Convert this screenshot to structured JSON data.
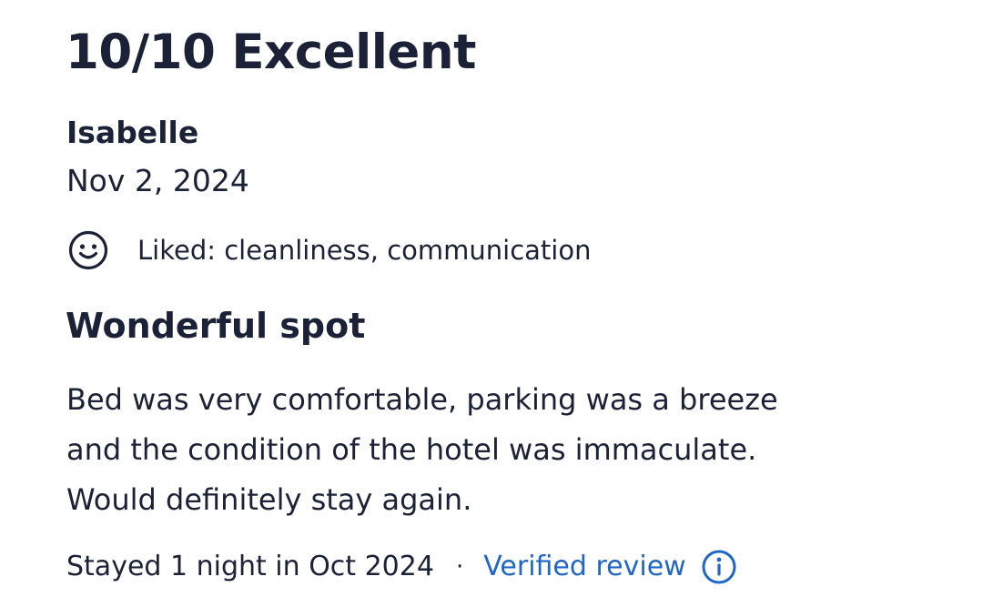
{
  "review": {
    "rating_heading": "10/10 Excellent",
    "reviewer_name": "Isabelle",
    "date": "Nov 2, 2024",
    "liked_icon": "smile-icon",
    "liked_text": "Liked: cleanliness, communication",
    "title": "Wonderful spot",
    "body_lines": [
      "Bed was very comfortable, parking was a breeze",
      "and the condition of the hotel was immaculate.",
      "Would definitely stay again."
    ],
    "stay_text": "Stayed 1 night in Oct 2024",
    "separator": "·",
    "verified_label": "Verified review",
    "info_icon": "info-icon"
  },
  "colors": {
    "text": "#1b2137",
    "link": "#1f66c9",
    "background": "#ffffff"
  }
}
